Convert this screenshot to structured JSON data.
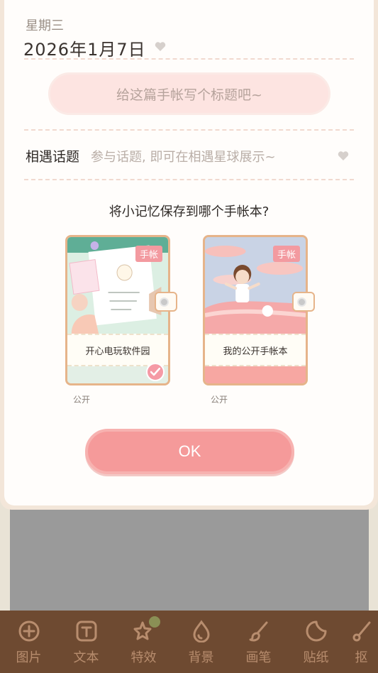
{
  "dialog": {
    "weekday": "星期三",
    "date": "2026年1月7日",
    "title_placeholder": "给这篇手帐写个标题吧~",
    "topic_label": "相遇话题",
    "topic_hint": "参与话题, 即可在相遇星球展示~",
    "question": "将小记忆保存到哪个手帐本?",
    "notebooks": [
      {
        "tag": "手帐",
        "name": "开心电玩软件园",
        "privacy": "公开",
        "selected": true
      },
      {
        "tag": "手帐",
        "name": "我的公开手帐本",
        "privacy": "公开",
        "selected": false
      }
    ],
    "ok_label": "OK"
  },
  "toolbar": {
    "items": [
      {
        "label": "图片",
        "icon": "add-circle-icon"
      },
      {
        "label": "文本",
        "icon": "text-box-icon"
      },
      {
        "label": "特效",
        "icon": "sparkle-star-icon"
      },
      {
        "label": "背景",
        "icon": "drop-icon"
      },
      {
        "label": "画笔",
        "icon": "brush-icon"
      },
      {
        "label": "贴纸",
        "icon": "sticker-icon"
      },
      {
        "label": "抠",
        "icon": "scissors-icon"
      }
    ]
  },
  "colors": {
    "accent_pink": "#f59a9a",
    "toolbar_bg": "#6e4a31",
    "toolbar_fg": "#b88d6e"
  }
}
